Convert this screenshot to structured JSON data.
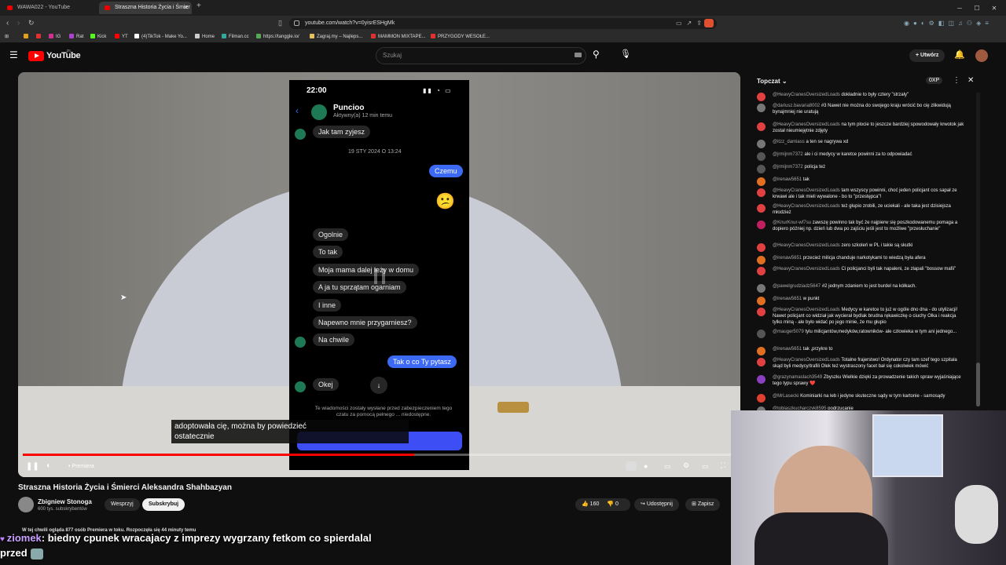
{
  "browser": {
    "tabs": [
      {
        "label": "WAWA022 - YouTube"
      },
      {
        "label": "Straszna Historia Życia i Śmier"
      }
    ],
    "url": "youtube.com/watch?v=0yisrESHgMk",
    "bookmarks": [
      "IG",
      "Rat",
      "Kick",
      "YT",
      "(4)TikTok - Make Yo...",
      "Home",
      "Filman.cc",
      "https://tanggle.io/",
      "Zagraj.my – Najleps...",
      "MAMMON MIXTAPE...",
      "PRZYGODY WESOŁE..."
    ]
  },
  "youtube": {
    "logo_text": "YouTube",
    "logo_region": "PL",
    "search_placeholder": "Szukaj",
    "create_label": "Utwórz"
  },
  "phone": {
    "time": "22:00",
    "contact_name": "Puncioo",
    "contact_status": "Aktywny(a) 12 min temu",
    "date_sep": "19 STY 2024 O 13:24",
    "messages_left_top": "Jak tam zyjesz",
    "msg_czemu": "Czemu",
    "emoji": "😕",
    "left_msgs": [
      "Ogolnie",
      "To tak",
      "Moja mama dalej leży w domu",
      "A ja tu sprzątam ogarniam",
      "I inne",
      "Napewno mnie przygarniesz?",
      "Na chwile"
    ],
    "msg_tak": "Tak o co Ty pytasz",
    "msg_okej": "Okej",
    "footer_text": "Te wiadomości zostały wysłane przed zabezpieczeniem tego czatu za pomocą pełnego ... niedostępne."
  },
  "subtitles": {
    "line1": "adoptowała cię, można by powiedzieć",
    "line2": "ostatecznie"
  },
  "player": {
    "premiere_label": "• Premiera",
    "progress": 0.55
  },
  "video_info": {
    "title": "Straszna Historia Życia i Śmierci Aleksandra Shahbazyan",
    "channel": "Zbigniew Stonoga",
    "subscribers": "600 tys. subskrybentów",
    "support_label": "Wesprzyj",
    "subscribe_label": "Subskrybuj",
    "likes": "160",
    "dislikes": "0",
    "share_label": "Udostępnij",
    "save_label": "Zapisz",
    "watching": "W tej chwili ogląda 877 osób  Premiera w toku. Rozpoczęła się 44 minuty temu"
  },
  "chat": {
    "header": "Topczat",
    "points": "0XP",
    "messages": [
      {
        "user": "@HeavyCranesOversizedLoads",
        "text": "dokładnie to były cztery \"strzały\"",
        "color": "#e04040"
      },
      {
        "user": "@dariusz.bavaria8002",
        "text": "#3 Nawet nie można do swojego kraju wrócić bo cię zlikwidują bynajmniej nie uratują",
        "color": "#777"
      },
      {
        "user": "@HeavyCranesOversizedLoads",
        "text": "na tym plocie to jeszcze bardziej spowodowały krwotok jak został nieumiejętnie zdjęty",
        "color": "#e04040"
      },
      {
        "user": "@itzz_damiass",
        "text": "a ten se nagrywa xd",
        "color": "#777"
      },
      {
        "user": "@jrmijnm7372",
        "text": "ale i ci medycy w karetce powinni za to odpowiadać",
        "color": "#555"
      },
      {
        "user": "@jrmijnm7372",
        "text": "policja też",
        "color": "#555"
      },
      {
        "user": "@irenaw5651",
        "text": "tak",
        "color": "#e07020"
      },
      {
        "user": "@HeavyCranesOversizedLoads",
        "text": "tam wszyscy powinni, choć jeden policjant cos sapał ze krwawi ale i tak mieli wywalone - bo to \"przestępca\"!",
        "color": "#e04040"
      },
      {
        "user": "@HeavyCranesOversizedLoads",
        "text": "też głupio zrobili, ze uciekali - ale taka jest dzisiejsza młodzież",
        "color": "#e04040"
      },
      {
        "user": "@KnurKnur-wf7su",
        "text": "zawszę powinno tak być że najpierw się poszkodowanemu pomaga a dopiero później np. dzień lub dwa po zajściu jeśli jest to możliwe \"przesłuchanie\"",
        "color": "#c02060"
      },
      {
        "user": "@HeavyCranesOversizedLoads",
        "text": "zero szkoleń w PL i takie są skutki",
        "color": "#e04040"
      },
      {
        "user": "@irenaw5651",
        "text": "przecież milicja chanduje narkotykami to wiedzą była afera",
        "color": "#e07020"
      },
      {
        "user": "@HeavyCranesOversizedLoads",
        "text": "Ci policjanci byli tak napaleni, ze złapali \"bossow mafii\"",
        "color": "#e04040"
      },
      {
        "user": "@pawelgrudziadz5647",
        "text": "#2 jednym zdaniem to jest burdel na kółkach.",
        "color": "#777"
      },
      {
        "user": "@irenaw5651",
        "text": "w punkt",
        "color": "#e07020"
      },
      {
        "user": "@HeavyCranesOversizedLoads",
        "text": "Medycy w karetce to już w ogóle dno dna - do utylizacji! Nawet policjant co widział jak wycierał bydlak brudna rękawiczkę o ciuchy Olka i reakcja tylko miną - ale było widać po jego minie, że mu głupio",
        "color": "#e04040"
      },
      {
        "user": "@mauger5079",
        "text": "tylu milicjantów,medyków,ratowników- ale człowieka w tym ani jednego...",
        "color": "#555"
      },
      {
        "user": "@irenaw5651",
        "text": "tak ,przykre to",
        "color": "#e07020"
      },
      {
        "user": "@HeavyCranesOversizedLoads",
        "text": "Totalne frajerstwo! Ordynator czy tam szef tego szpitala skąd byli medycy/trafili Olek też wystraszony facet bał się cokolwiek mówić",
        "color": "#e04040"
      },
      {
        "user": "@grazynamaslach3549",
        "text": "Zbyszku Wielkie dzięki za prowadzenie takich spraw wyjaśniające tego typu sprawy ❤️",
        "color": "#8a40c0"
      },
      {
        "user": "@MrLasecki",
        "text": "Kominiarki na łeb i jedyne skuteczne sądy w tym kartonie - samosądy",
        "color": "#e04030"
      },
      {
        "user": "@tobiaszkucharczyk8595",
        "text": "podrzucanie",
        "color": "#777"
      }
    ]
  },
  "overlay": {
    "line1_user": "ziomek",
    "line1_text": ": biedny cpunek wracajacy z imprezy wygrzany fetkom co spierdalal",
    "line2_text": "przed"
  }
}
